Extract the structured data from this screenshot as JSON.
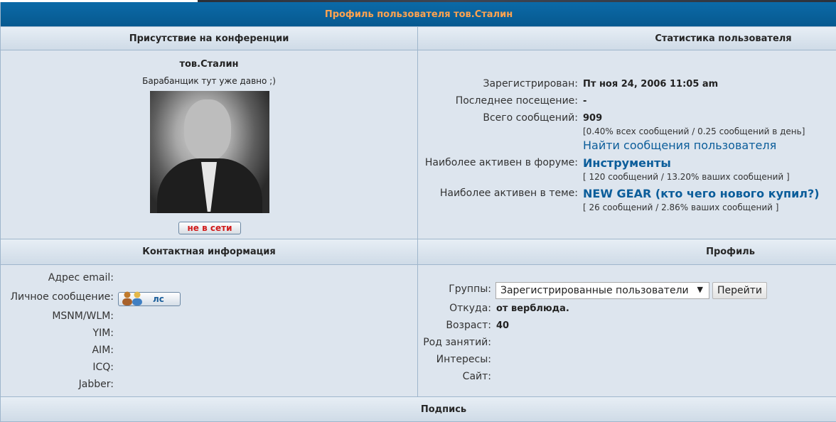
{
  "title": "Профиль пользователя тов.Сталин",
  "sections": {
    "presence": "Присутствие на конференции",
    "stats": "Статистика пользователя",
    "contact": "Контактная информация",
    "profile": "Профиль",
    "signature": "Подпись"
  },
  "user": {
    "name": "тов.Сталин",
    "rank": "Барабанщик тут уже давно ;)",
    "online_status": "не в сети"
  },
  "stats": {
    "registered_label": "Зарегистрирован:",
    "registered_value": "Пт ноя 24, 2006 11:05 am",
    "last_visit_label": "Последнее посещение:",
    "last_visit_value": "-",
    "posts_label": "Всего сообщений:",
    "posts_value": "909",
    "posts_detail": "[0.40% всех сообщений / 0.25 сообщений в день]",
    "find_posts_link": "Найти сообщения пользователя",
    "active_forum_label": "Наиболее активен в форуме:",
    "active_forum_value": "Инструменты",
    "active_forum_detail": "[ 120 сообщений / 13.20% ваших сообщений ]",
    "active_topic_label": "Наиболее активен в теме:",
    "active_topic_value": "NEW GEAR (кто чего нового купил?)",
    "active_topic_detail": "[ 26 сообщений / 2.86% ваших сообщений ]"
  },
  "contact": {
    "email_label": "Адрес email:",
    "pm_label": "Личное сообщение:",
    "pm_button": "лс",
    "msnm_label": "MSNM/WLM:",
    "yim_label": "YIM:",
    "aim_label": "AIM:",
    "icq_label": "ICQ:",
    "jabber_label": "Jabber:"
  },
  "profile": {
    "groups_label": "Группы:",
    "groups_selected": "Зарегистрированные пользователи",
    "go_button": "Перейти",
    "from_label": "Откуда:",
    "from_value": "от верблюда.",
    "age_label": "Возраст:",
    "age_value": "40",
    "occupation_label": "Род занятий:",
    "interests_label": "Интересы:",
    "site_label": "Сайт:"
  },
  "icons": {
    "dropdown": "triangle-down",
    "pm": "two-people-icon"
  },
  "colors": {
    "title_bar": "#07598f",
    "title_text": "#ffa34f",
    "link": "#0b5d9a",
    "offline": "#d11b1b"
  }
}
